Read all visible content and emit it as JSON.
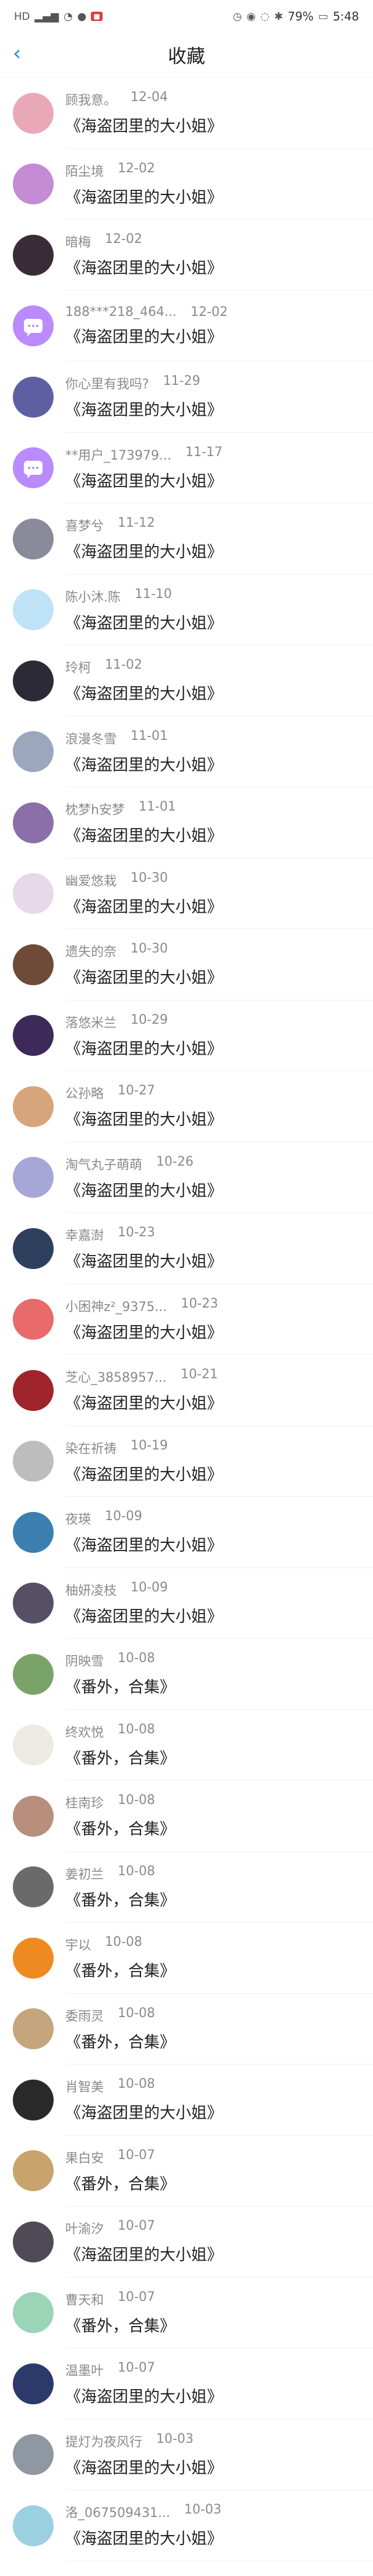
{
  "status": {
    "icons_left": [
      "HD",
      "signal-icon",
      "wifi-icon",
      "app-icon",
      "shopping-icon"
    ],
    "battery": "79%",
    "time": "5:48"
  },
  "header": {
    "title": "收藏"
  },
  "items": [
    {
      "name": "顾我意。",
      "date": "12-04",
      "title": "《海盗团里的大小姐》",
      "avatar_color": "#e9a8b8"
    },
    {
      "name": "陌尘境",
      "date": "12-02",
      "title": "《海盗团里的大小姐》",
      "avatar_color": "#c58bd5"
    },
    {
      "name": "暗梅",
      "date": "12-02",
      "title": "《海盗团里的大小姐》",
      "avatar_color": "#3b2d38"
    },
    {
      "name": "188***218_464...",
      "date": "12-02",
      "title": "《海盗团里的大小姐》",
      "avatar_color": "default"
    },
    {
      "name": "你心里有我吗?",
      "date": "11-29",
      "title": "《海盗团里的大小姐》",
      "avatar_color": "#5e5fa3"
    },
    {
      "name": "**用户_173979...",
      "date": "11-17",
      "title": "《海盗团里的大小姐》",
      "avatar_color": "default"
    },
    {
      "name": "喜梦兮",
      "date": "11-12",
      "title": "《海盗团里的大小姐》",
      "avatar_color": "#8a8a9a"
    },
    {
      "name": "陈小沐.陈",
      "date": "11-10",
      "title": "《海盗团里的大小姐》",
      "avatar_color": "#bfe3f6"
    },
    {
      "name": "玲柯",
      "date": "11-02",
      "title": "《海盗团里的大小姐》",
      "avatar_color": "#2c2a36"
    },
    {
      "name": "浪漫冬雪",
      "date": "11-01",
      "title": "《海盗团里的大小姐》",
      "avatar_color": "#9aa7bd"
    },
    {
      "name": "枕梦h安梦",
      "date": "11-01",
      "title": "《海盗团里的大小姐》",
      "avatar_color": "#8a6fa9"
    },
    {
      "name": "幽爱悠栽",
      "date": "10-30",
      "title": "《海盗团里的大小姐》",
      "avatar_color": "#e7d9ea"
    },
    {
      "name": "遗失的奈",
      "date": "10-30",
      "title": "《海盗团里的大小姐》",
      "avatar_color": "#6d4b38"
    },
    {
      "name": "落悠米兰",
      "date": "10-29",
      "title": "《海盗团里的大小姐》",
      "avatar_color": "#3d2a59"
    },
    {
      "name": "公孙略",
      "date": "10-27",
      "title": "《海盗团里的大小姐》",
      "avatar_color": "#d7a57c"
    },
    {
      "name": "淘气丸子萌萌",
      "date": "10-26",
      "title": "《海盗团里的大小姐》",
      "avatar_color": "#a7a6d8"
    },
    {
      "name": "幸嘉澍",
      "date": "10-23",
      "title": "《海盗团里的大小姐》",
      "avatar_color": "#2e3f5e"
    },
    {
      "name": "小困神z²_9375...",
      "date": "10-23",
      "title": "《海盗团里的大小姐》",
      "avatar_color": "#e86a6a"
    },
    {
      "name": "芝心_3858957...",
      "date": "10-21",
      "title": "《海盗团里的大小姐》",
      "avatar_color": "#a0242c"
    },
    {
      "name": "染在祈祷",
      "date": "10-19",
      "title": "《海盗团里的大小姐》",
      "avatar_color": "#bdbdbd"
    },
    {
      "name": "夜瑛",
      "date": "10-09",
      "title": "《海盗团里的大小姐》",
      "avatar_color": "#3a7fb0"
    },
    {
      "name": "柚妍凌枝",
      "date": "10-09",
      "title": "《海盗团里的大小姐》",
      "avatar_color": "#565067"
    },
    {
      "name": "阴映雪",
      "date": "10-08",
      "title": "《番外，合集》",
      "avatar_color": "#7aa36a"
    },
    {
      "name": "终欢悦",
      "date": "10-08",
      "title": "《番外，合集》",
      "avatar_color": "#eceae2"
    },
    {
      "name": "桂南珍",
      "date": "10-08",
      "title": "《番外，合集》",
      "avatar_color": "#b88e7c"
    },
    {
      "name": "姜初兰",
      "date": "10-08",
      "title": "《番外，合集》",
      "avatar_color": "#6a6a6a"
    },
    {
      "name": "宇以",
      "date": "10-08",
      "title": "《番外，合集》",
      "avatar_color": "#ef8a21"
    },
    {
      "name": "委雨灵",
      "date": "10-08",
      "title": "《番外，合集》",
      "avatar_color": "#c4a57d"
    },
    {
      "name": "肖智美",
      "date": "10-08",
      "title": "《海盗团里的大小姐》",
      "avatar_color": "#2a2a2a"
    },
    {
      "name": "果白安",
      "date": "10-07",
      "title": "《番外，合集》",
      "avatar_color": "#c9a36d"
    },
    {
      "name": "叶渝汐",
      "date": "10-07",
      "title": "《海盗团里的大小姐》",
      "avatar_color": "#504a56"
    },
    {
      "name": "曹天和",
      "date": "10-07",
      "title": "《番外，合集》",
      "avatar_color": "#9bd5b7"
    },
    {
      "name": "温墨叶",
      "date": "10-07",
      "title": "《海盗团里的大小姐》",
      "avatar_color": "#2c3a6b"
    },
    {
      "name": "提灯为夜风行",
      "date": "10-03",
      "title": "《海盗团里的大小姐》",
      "avatar_color": "#8f97a2"
    },
    {
      "name": "洛_067509431...",
      "date": "10-03",
      "title": "《海盗团里的大小姐》",
      "avatar_color": "#9ad0df"
    }
  ]
}
